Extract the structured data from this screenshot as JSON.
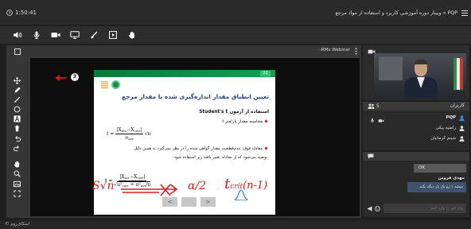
{
  "window": {
    "timer": "1:50:41",
    "title": "PQP » وبینار دوره آموزشی کاربرد و استفاده از مواد مرجع",
    "footer": "اسکای‌روم ©"
  },
  "toolbar": {
    "icons": [
      "speaker-icon",
      "microphone-icon",
      "camera-icon",
      "screen-share-icon",
      "brush-icon",
      "media-icon",
      "raise-hand-icon"
    ]
  },
  "presentation": {
    "label": "-RMx Webinar",
    "badge": "3",
    "tools": [
      "move-icon",
      "pen-icon",
      "line-icon",
      "circle-icon",
      "text-icon",
      "trash-icon",
      "undo-icon",
      "redo-icon",
      "hand-icon",
      "zoom-icon",
      "image-icon",
      "fullscreen-icon"
    ],
    "slide": {
      "number": "22",
      "title": "تعیین انطباق مقدار اندازه‌گیری شده با مقدار مرجع",
      "method": "استفاده از آزمون Student's t",
      "bullet1": "محاسبه مقدار پارامتر t",
      "formula1": {
        "lhs": "t =",
        "num": [
          "|X",
          "avr",
          "−X",
          "cert",
          "|"
        ],
        "den": [
          "σ",
          "avr"
        ],
        "factor": "√n"
      },
      "bullet2": [
        "معادله فوق، عدم‌قطعیت مقدار گواهی شده را در نظر نمی‌گیرد به همین دلیل",
        "توصیه می‌شود که از معادله تغییر یافته زیر استفاده شود:"
      ],
      "formula2": {
        "lhs": "t =",
        "num": [
          "|X",
          "avr",
          "−X",
          "cert",
          "|"
        ],
        "den": [
          "u²",
          "cert",
          " + ",
          "σ²",
          "avr",
          "/n"
        ]
      },
      "nav": {
        "prev": "<",
        "next": ">"
      }
    },
    "annotations": {
      "left": "S√n",
      "middle": "α/2",
      "right_main": "t",
      "right_sub": "crit",
      "right_tail": "(n-1)"
    }
  },
  "users": {
    "title": "کاربران",
    "count": "5",
    "list": [
      {
        "name": "PQP"
      },
      {
        "name": "راضیه بیکی"
      },
      {
        "name": "شبنم کرمانیان"
      }
    ]
  },
  "chat": {
    "messages": [
      {
        "text": "OK"
      },
      {
        "author": "مهدی فروتن",
        "text": "میشه ۱ رو یک بار دیگه بگید"
      }
    ],
    "placeholder": "پیام خود را وارد کنید"
  },
  "colors": {
    "slide_accent": "#0b8a46",
    "slide_title": "#1d3f8f",
    "ink": "#e11b1b",
    "presenter_icon": "#3b8ee8"
  }
}
